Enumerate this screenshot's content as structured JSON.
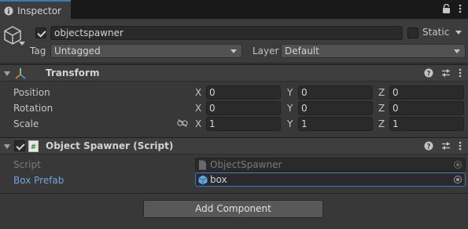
{
  "tab": {
    "label": "Inspector"
  },
  "object": {
    "active": true,
    "name": "objectspawner",
    "static_label": "Static",
    "tag_label": "Tag",
    "tag_value": "Untagged",
    "layer_label": "Layer",
    "layer_value": "Default"
  },
  "transform": {
    "title": "Transform",
    "rows": [
      {
        "label": "Position",
        "x": "0",
        "y": "0",
        "z": "0"
      },
      {
        "label": "Rotation",
        "x": "0",
        "y": "0",
        "z": "0"
      },
      {
        "label": "Scale",
        "x": "1",
        "y": "1",
        "z": "1"
      }
    ],
    "axes": {
      "x": "X",
      "y": "Y",
      "z": "Z"
    }
  },
  "object_spawner": {
    "title": "Object Spawner (Script)",
    "script_label": "Script",
    "script_value": "ObjectSpawner",
    "box_prefab_label": "Box Prefab",
    "box_prefab_value": "box"
  },
  "add_component_label": "Add Component",
  "colors": {
    "accent": "#3a79bb",
    "link_label": "#6ea4dc",
    "background": "#383838"
  }
}
